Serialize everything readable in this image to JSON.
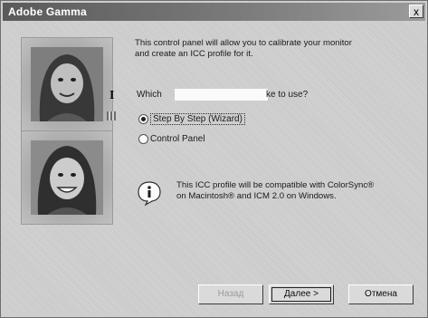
{
  "window": {
    "title": "Adobe Gamma",
    "close_glyph": "x"
  },
  "content": {
    "description": "This control panel will allow you to calibrate your monitor and create an ICC profile for it.",
    "question_prefix": "Which",
    "question_suffix": "ke to use?",
    "cursor_glyph": "I",
    "options": [
      {
        "label": "Step By Step (Wizard)",
        "selected": true
      },
      {
        "label": "Control Panel",
        "selected": false
      }
    ],
    "info_icon": "info-icon",
    "info_text": "This ICC profile will be compatible with ColorSync® on Macintosh® and ICM 2.0 on Windows."
  },
  "buttons": {
    "back": "Назад",
    "next": "Далее >",
    "cancel": "Отмена"
  }
}
